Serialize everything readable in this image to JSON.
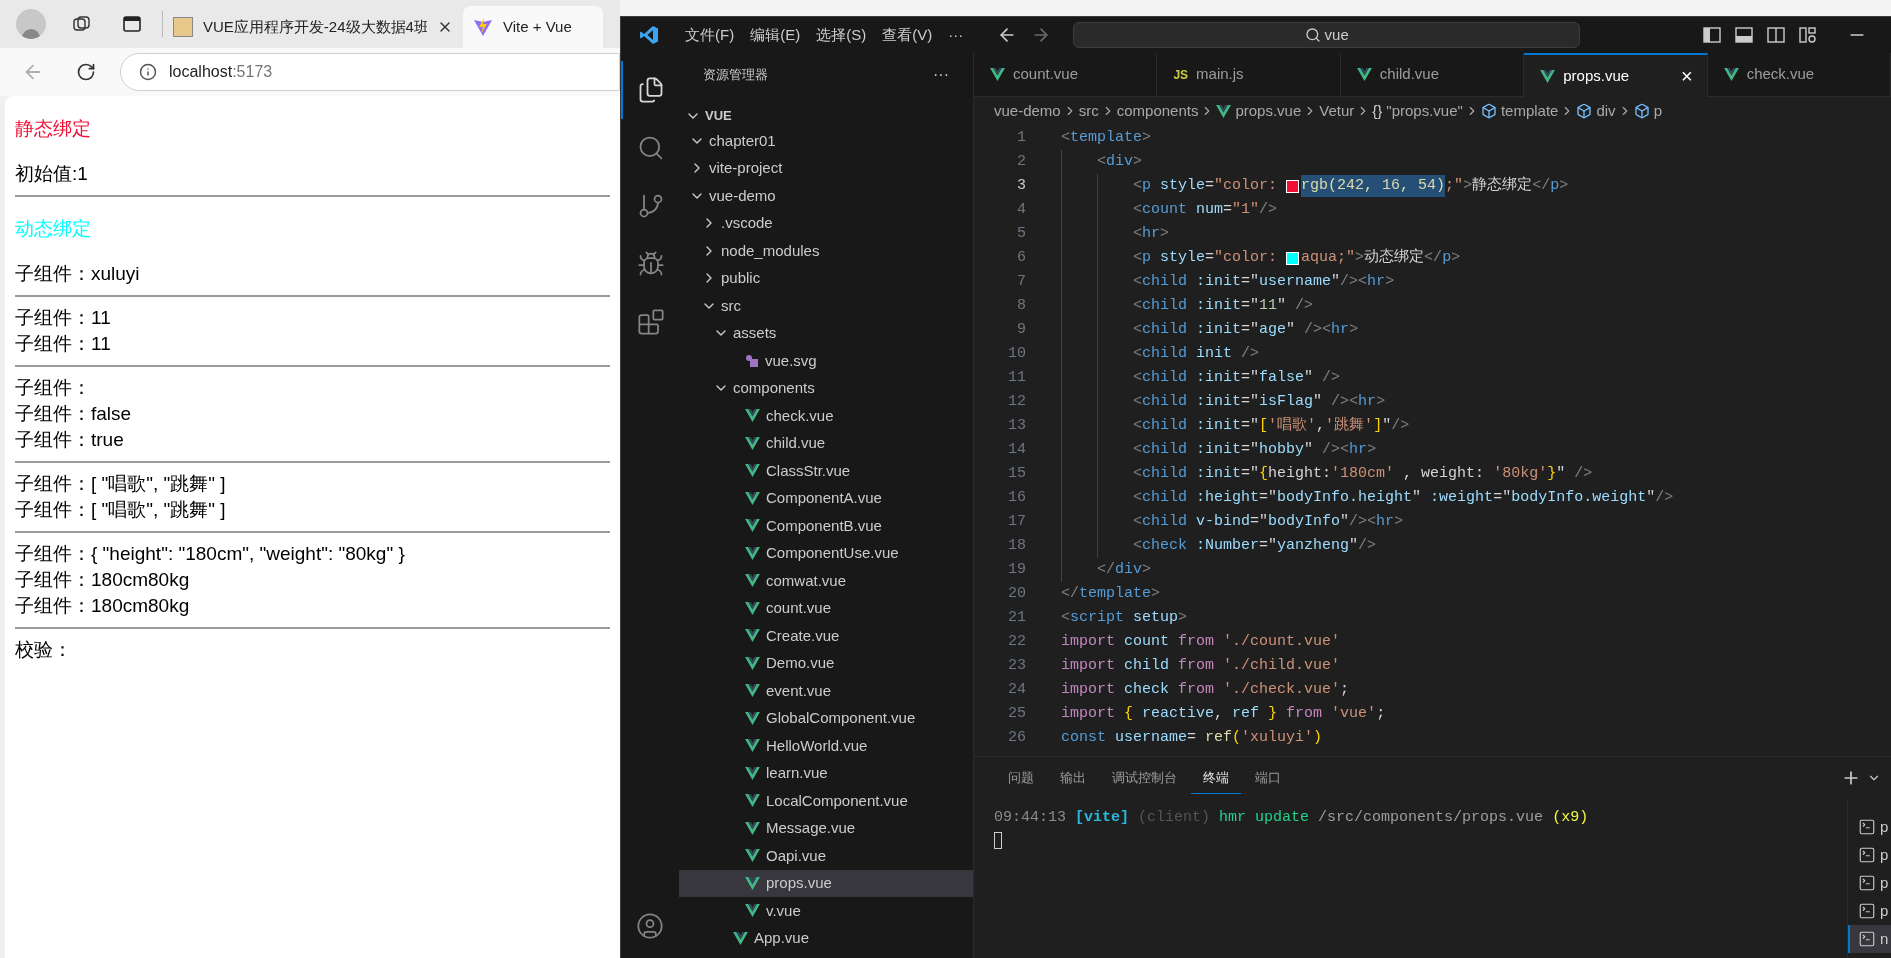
{
  "browser": {
    "tabs": [
      {
        "title": "VUE应用程序开发-24级大数据4班",
        "kind": "page",
        "selected": false,
        "closable": true
      },
      {
        "title": "Vite + Vue",
        "kind": "vite",
        "selected": true,
        "closable": false
      }
    ],
    "address": {
      "host": "localhost",
      "port": ":5173"
    },
    "page": [
      {
        "kind": "p",
        "text": "静态绑定",
        "color": "#f21036"
      },
      {
        "kind": "div",
        "text": "初始值:1",
        "color": "#000000"
      },
      {
        "kind": "hr"
      },
      {
        "kind": "p",
        "text": "动态绑定",
        "color": "#00ffff"
      },
      {
        "kind": "div",
        "text": "子组件：xuluyi",
        "color": "#000000"
      },
      {
        "kind": "hr"
      },
      {
        "kind": "div",
        "text": "子组件：11",
        "color": "#000000"
      },
      {
        "kind": "div",
        "text": "子组件：11",
        "color": "#000000"
      },
      {
        "kind": "hr"
      },
      {
        "kind": "div",
        "text": "子组件：",
        "color": "#000000"
      },
      {
        "kind": "div",
        "text": "子组件：false",
        "color": "#000000"
      },
      {
        "kind": "div",
        "text": "子组件：true",
        "color": "#000000"
      },
      {
        "kind": "hr"
      },
      {
        "kind": "div",
        "text": "子组件：[ \"唱歌\", \"跳舞\" ]",
        "color": "#000000"
      },
      {
        "kind": "div",
        "text": "子组件：[ \"唱歌\", \"跳舞\" ]",
        "color": "#000000"
      },
      {
        "kind": "hr"
      },
      {
        "kind": "div",
        "text": "子组件：{ \"height\": \"180cm\", \"weight\": \"80kg\" }",
        "color": "#000000"
      },
      {
        "kind": "div",
        "text": "子组件：180cm80kg",
        "color": "#000000"
      },
      {
        "kind": "div",
        "text": "子组件：180cm80kg",
        "color": "#000000"
      },
      {
        "kind": "hr"
      },
      {
        "kind": "div",
        "text": "校验：",
        "color": "#000000"
      }
    ]
  },
  "editor_window": {
    "menu": [
      "文件(F)",
      "编辑(E)",
      "选择(S)",
      "查看(V)",
      "···"
    ],
    "search": {
      "value": "vue"
    },
    "activity_bar": [
      {
        "kind": "explorer",
        "selected": true
      },
      {
        "kind": "search",
        "selected": false
      },
      {
        "kind": "source-control",
        "selected": false
      },
      {
        "kind": "run-debug",
        "selected": false
      },
      {
        "kind": "extensions",
        "selected": false
      }
    ],
    "sidebar": {
      "title": "资源管理器",
      "more": "···",
      "section": "VUE",
      "tree": [
        {
          "label": "chapter01",
          "kind": "folder",
          "expanded": true,
          "selected": false
        },
        {
          "label": "vite-project",
          "kind": "folder",
          "expanded": false,
          "selected": false
        },
        {
          "label": "vue-demo",
          "kind": "folder",
          "expanded": true,
          "selected": false,
          "children": [
            {
              "label": ".vscode",
              "kind": "folder",
              "expanded": false,
              "selected": false
            },
            {
              "label": "node_modules",
              "kind": "folder",
              "expanded": false,
              "selected": false
            },
            {
              "label": "public",
              "kind": "folder",
              "expanded": false,
              "selected": false
            },
            {
              "label": "src",
              "kind": "folder",
              "expanded": true,
              "selected": false,
              "children": [
                {
                  "label": "assets",
                  "kind": "folder",
                  "expanded": true,
                  "selected": false,
                  "children": [
                    {
                      "label": "vue.svg",
                      "kind": "svg",
                      "selected": false
                    }
                  ]
                },
                {
                  "label": "components",
                  "kind": "folder",
                  "expanded": true,
                  "selected": false,
                  "children": [
                    {
                      "label": "check.vue",
                      "kind": "vue",
                      "selected": false
                    },
                    {
                      "label": "child.vue",
                      "kind": "vue",
                      "selected": false
                    },
                    {
                      "label": "ClassStr.vue",
                      "kind": "vue",
                      "selected": false
                    },
                    {
                      "label": "ComponentA.vue",
                      "kind": "vue",
                      "selected": false
                    },
                    {
                      "label": "ComponentB.vue",
                      "kind": "vue",
                      "selected": false
                    },
                    {
                      "label": "ComponentUse.vue",
                      "kind": "vue",
                      "selected": false
                    },
                    {
                      "label": "comwat.vue",
                      "kind": "vue",
                      "selected": false
                    },
                    {
                      "label": "count.vue",
                      "kind": "vue",
                      "selected": false
                    },
                    {
                      "label": "Create.vue",
                      "kind": "vue",
                      "selected": false
                    },
                    {
                      "label": "Demo.vue",
                      "kind": "vue",
                      "selected": false
                    },
                    {
                      "label": "event.vue",
                      "kind": "vue",
                      "selected": false
                    },
                    {
                      "label": "GlobalComponent.vue",
                      "kind": "vue",
                      "selected": false
                    },
                    {
                      "label": "HelloWorld.vue",
                      "kind": "vue",
                      "selected": false
                    },
                    {
                      "label": "learn.vue",
                      "kind": "vue",
                      "selected": false
                    },
                    {
                      "label": "LocalComponent.vue",
                      "kind": "vue",
                      "selected": false
                    },
                    {
                      "label": "Message.vue",
                      "kind": "vue",
                      "selected": false
                    },
                    {
                      "label": "Oapi.vue",
                      "kind": "vue",
                      "selected": false
                    },
                    {
                      "label": "props.vue",
                      "kind": "vue",
                      "selected": true
                    },
                    {
                      "label": "v.vue",
                      "kind": "vue",
                      "selected": false
                    }
                  ]
                },
                {
                  "label": "App.vue",
                  "kind": "vue",
                  "selected": false
                }
              ]
            }
          ]
        }
      ]
    },
    "tabs": [
      {
        "label": "count.vue",
        "kind": "vue",
        "selected": false
      },
      {
        "label": "main.js",
        "kind": "js",
        "badge": "JS",
        "selected": false
      },
      {
        "label": "child.vue",
        "kind": "vue",
        "selected": false
      },
      {
        "label": "props.vue",
        "kind": "vue",
        "selected": true,
        "close": "×"
      },
      {
        "label": "check.vue",
        "kind": "vue",
        "selected": false
      }
    ],
    "breadcrumb": [
      {
        "label": "vue-demo",
        "kind": "folder"
      },
      {
        "label": "src",
        "kind": "folder"
      },
      {
        "label": "components",
        "kind": "folder"
      },
      {
        "label": "props.vue",
        "kind": "vue"
      },
      {
        "label": "Vetur",
        "kind": "folder"
      },
      {
        "label": "\"props.vue\"",
        "kind": "object",
        "symbol": "{}"
      },
      {
        "label": "template",
        "kind": "element"
      },
      {
        "label": "div",
        "kind": "element"
      },
      {
        "label": "p",
        "kind": "element"
      }
    ],
    "code": [
      {
        "number": "1",
        "active": false,
        "tokens": [
          {
            "kind": "punct",
            "text": "<"
          },
          {
            "kind": "tag",
            "text": "template"
          },
          {
            "kind": "punct",
            "text": ">"
          }
        ]
      },
      {
        "number": "2",
        "active": false,
        "tokens": [
          {
            "kind": "punct",
            "text": "    <"
          },
          {
            "kind": "tag",
            "text": "div"
          },
          {
            "kind": "punct",
            "text": ">"
          }
        ]
      },
      {
        "number": "3",
        "active": true,
        "tokens": [
          {
            "kind": "punct",
            "text": "        <"
          },
          {
            "kind": "tag",
            "text": "p"
          },
          {
            "kind": "attr",
            "text": " style"
          },
          {
            "kind": "plain",
            "text": "="
          },
          {
            "kind": "string",
            "text": "\"color: "
          },
          {
            "kind": "swatch",
            "color": "#f21036"
          },
          {
            "kind": "selection",
            "text": "rgb(242, 16, 54)"
          },
          {
            "kind": "string",
            "text": ";\""
          },
          {
            "kind": "punct",
            "text": ">"
          },
          {
            "kind": "plain",
            "text": "静态绑定"
          },
          {
            "kind": "punct",
            "text": "</"
          },
          {
            "kind": "tag",
            "text": "p"
          },
          {
            "kind": "punct",
            "text": ">"
          }
        ]
      },
      {
        "number": "4",
        "active": false,
        "tokens": [
          {
            "kind": "punct",
            "text": "        <"
          },
          {
            "kind": "tag",
            "text": "count"
          },
          {
            "kind": "attr",
            "text": " num"
          },
          {
            "kind": "plain",
            "text": "="
          },
          {
            "kind": "string",
            "text": "\"1\""
          },
          {
            "kind": "punct",
            "text": "/>"
          }
        ]
      },
      {
        "number": "5",
        "active": false,
        "tokens": [
          {
            "kind": "punct",
            "text": "        <"
          },
          {
            "kind": "tag",
            "text": "hr"
          },
          {
            "kind": "punct",
            "text": ">"
          }
        ]
      },
      {
        "number": "6",
        "active": false,
        "tokens": [
          {
            "kind": "punct",
            "text": "        <"
          },
          {
            "kind": "tag",
            "text": "p"
          },
          {
            "kind": "attr",
            "text": " style"
          },
          {
            "kind": "plain",
            "text": "="
          },
          {
            "kind": "string",
            "text": "\"color: "
          },
          {
            "kind": "swatch",
            "color": "#00ffff"
          },
          {
            "kind": "string",
            "text": "aqua;\""
          },
          {
            "kind": "punct",
            "text": ">"
          },
          {
            "kind": "plain",
            "text": "动态绑定"
          },
          {
            "kind": "punct",
            "text": "</"
          },
          {
            "kind": "tag",
            "text": "p"
          },
          {
            "kind": "punct",
            "text": ">"
          }
        ]
      },
      {
        "number": "7",
        "active": false,
        "tokens": [
          {
            "kind": "punct",
            "text": "        <"
          },
          {
            "kind": "tag",
            "text": "child"
          },
          {
            "kind": "attr",
            "text": " :init"
          },
          {
            "kind": "plain",
            "text": "=\""
          },
          {
            "kind": "expr",
            "text": "username"
          },
          {
            "kind": "plain",
            "text": "\""
          },
          {
            "kind": "punct",
            "text": "/><"
          },
          {
            "kind": "tag",
            "text": "hr"
          },
          {
            "kind": "punct",
            "text": ">"
          }
        ]
      },
      {
        "number": "8",
        "active": false,
        "tokens": [
          {
            "kind": "punct",
            "text": "        <"
          },
          {
            "kind": "tag",
            "text": "child"
          },
          {
            "kind": "attr",
            "text": " :init"
          },
          {
            "kind": "plain",
            "text": "=\""
          },
          {
            "kind": "number",
            "text": "11"
          },
          {
            "kind": "plain",
            "text": "\" "
          },
          {
            "kind": "punct",
            "text": "/>"
          }
        ]
      },
      {
        "number": "9",
        "active": false,
        "tokens": [
          {
            "kind": "punct",
            "text": "        <"
          },
          {
            "kind": "tag",
            "text": "child"
          },
          {
            "kind": "attr",
            "text": " :init"
          },
          {
            "kind": "plain",
            "text": "=\""
          },
          {
            "kind": "expr",
            "text": "age"
          },
          {
            "kind": "plain",
            "text": "\" "
          },
          {
            "kind": "punct",
            "text": "/><"
          },
          {
            "kind": "tag",
            "text": "hr"
          },
          {
            "kind": "punct",
            "text": ">"
          }
        ]
      },
      {
        "number": "10",
        "active": false,
        "tokens": [
          {
            "kind": "punct",
            "text": "        <"
          },
          {
            "kind": "tag",
            "text": "child"
          },
          {
            "kind": "attr",
            "text": " init "
          },
          {
            "kind": "punct",
            "text": "/>"
          }
        ]
      },
      {
        "number": "11",
        "active": false,
        "tokens": [
          {
            "kind": "punct",
            "text": "        <"
          },
          {
            "kind": "tag",
            "text": "child"
          },
          {
            "kind": "attr",
            "text": " :init"
          },
          {
            "kind": "plain",
            "text": "=\""
          },
          {
            "kind": "expr",
            "text": "false"
          },
          {
            "kind": "plain",
            "text": "\" "
          },
          {
            "kind": "punct",
            "text": "/>"
          }
        ]
      },
      {
        "number": "12",
        "active": false,
        "tokens": [
          {
            "kind": "punct",
            "text": "        <"
          },
          {
            "kind": "tag",
            "text": "child"
          },
          {
            "kind": "attr",
            "text": " :init"
          },
          {
            "kind": "plain",
            "text": "=\""
          },
          {
            "kind": "expr",
            "text": "isFlag"
          },
          {
            "kind": "plain",
            "text": "\" "
          },
          {
            "kind": "punct",
            "text": "/><"
          },
          {
            "kind": "tag",
            "text": "hr"
          },
          {
            "kind": "punct",
            "text": ">"
          }
        ]
      },
      {
        "number": "13",
        "active": false,
        "tokens": [
          {
            "kind": "punct",
            "text": "        <"
          },
          {
            "kind": "tag",
            "text": "child"
          },
          {
            "kind": "attr",
            "text": " :init"
          },
          {
            "kind": "plain",
            "text": "=\""
          },
          {
            "kind": "bracket",
            "text": "["
          },
          {
            "kind": "string",
            "text": "'唱歌'"
          },
          {
            "kind": "plain",
            "text": ","
          },
          {
            "kind": "string",
            "text": "'跳舞'"
          },
          {
            "kind": "bracket",
            "text": "]"
          },
          {
            "kind": "plain",
            "text": "\""
          },
          {
            "kind": "punct",
            "text": "/>"
          }
        ]
      },
      {
        "number": "14",
        "active": false,
        "tokens": [
          {
            "kind": "punct",
            "text": "        <"
          },
          {
            "kind": "tag",
            "text": "child"
          },
          {
            "kind": "attr",
            "text": " :init"
          },
          {
            "kind": "plain",
            "text": "=\""
          },
          {
            "kind": "expr",
            "text": "hobby"
          },
          {
            "kind": "plain",
            "text": "\" "
          },
          {
            "kind": "punct",
            "text": "/><"
          },
          {
            "kind": "tag",
            "text": "hr"
          },
          {
            "kind": "punct",
            "text": ">"
          }
        ]
      },
      {
        "number": "15",
        "active": false,
        "tokens": [
          {
            "kind": "punct",
            "text": "        <"
          },
          {
            "kind": "tag",
            "text": "child"
          },
          {
            "kind": "attr",
            "text": " :init"
          },
          {
            "kind": "plain",
            "text": "=\""
          },
          {
            "kind": "bracket",
            "text": "{"
          },
          {
            "kind": "plain",
            "text": "height:"
          },
          {
            "kind": "string",
            "text": "'180cm'"
          },
          {
            "kind": "plain",
            "text": " , weight: "
          },
          {
            "kind": "string",
            "text": "'80kg'"
          },
          {
            "kind": "bracket",
            "text": "}"
          },
          {
            "kind": "plain",
            "text": "\" "
          },
          {
            "kind": "punct",
            "text": "/>"
          }
        ]
      },
      {
        "number": "16",
        "active": false,
        "tokens": [
          {
            "kind": "punct",
            "text": "        <"
          },
          {
            "kind": "tag",
            "text": "child"
          },
          {
            "kind": "attr",
            "text": " :height"
          },
          {
            "kind": "plain",
            "text": "=\""
          },
          {
            "kind": "expr",
            "text": "bodyInfo.height"
          },
          {
            "kind": "plain",
            "text": "\""
          },
          {
            "kind": "attr",
            "text": " :weight"
          },
          {
            "kind": "plain",
            "text": "=\""
          },
          {
            "kind": "expr",
            "text": "bodyInfo.weight"
          },
          {
            "kind": "plain",
            "text": "\""
          },
          {
            "kind": "punct",
            "text": "/>"
          }
        ]
      },
      {
        "number": "17",
        "active": false,
        "tokens": [
          {
            "kind": "punct",
            "text": "        <"
          },
          {
            "kind": "tag",
            "text": "child"
          },
          {
            "kind": "attr",
            "text": " v-bind"
          },
          {
            "kind": "plain",
            "text": "=\""
          },
          {
            "kind": "expr",
            "text": "bodyInfo"
          },
          {
            "kind": "plain",
            "text": "\""
          },
          {
            "kind": "punct",
            "text": "/><"
          },
          {
            "kind": "tag",
            "text": "hr"
          },
          {
            "kind": "punct",
            "text": ">"
          }
        ]
      },
      {
        "number": "18",
        "active": false,
        "tokens": [
          {
            "kind": "punct",
            "text": "        <"
          },
          {
            "kind": "tag",
            "text": "check"
          },
          {
            "kind": "attr",
            "text": " :Number"
          },
          {
            "kind": "plain",
            "text": "=\""
          },
          {
            "kind": "expr",
            "text": "yanzheng"
          },
          {
            "kind": "plain",
            "text": "\""
          },
          {
            "kind": "punct",
            "text": "/>"
          }
        ]
      },
      {
        "number": "19",
        "active": false,
        "tokens": [
          {
            "kind": "punct",
            "text": "    </"
          },
          {
            "kind": "tag",
            "text": "div"
          },
          {
            "kind": "punct",
            "text": ">"
          }
        ]
      },
      {
        "number": "20",
        "active": false,
        "tokens": [
          {
            "kind": "punct",
            "text": "</"
          },
          {
            "kind": "tag",
            "text": "template"
          },
          {
            "kind": "punct",
            "text": ">"
          }
        ]
      },
      {
        "number": "21",
        "active": false,
        "tokens": [
          {
            "kind": "punct",
            "text": "<"
          },
          {
            "kind": "tag",
            "text": "script"
          },
          {
            "kind": "attr",
            "text": " setup"
          },
          {
            "kind": "punct",
            "text": ">"
          }
        ]
      },
      {
        "number": "22",
        "active": false,
        "tokens": [
          {
            "kind": "keyword",
            "text": "import"
          },
          {
            "kind": "expr",
            "text": " count "
          },
          {
            "kind": "keyword",
            "text": "from"
          },
          {
            "kind": "string",
            "text": " './count.vue'"
          }
        ]
      },
      {
        "number": "23",
        "active": false,
        "tokens": [
          {
            "kind": "keyword",
            "text": "import"
          },
          {
            "kind": "expr",
            "text": " child "
          },
          {
            "kind": "keyword",
            "text": "from"
          },
          {
            "kind": "string",
            "text": " './child.vue'"
          }
        ]
      },
      {
        "number": "24",
        "active": false,
        "tokens": [
          {
            "kind": "keyword",
            "text": "import"
          },
          {
            "kind": "expr",
            "text": " check "
          },
          {
            "kind": "keyword",
            "text": "from"
          },
          {
            "kind": "string",
            "text": " './check.vue'"
          },
          {
            "kind": "plain",
            "text": ";"
          }
        ]
      },
      {
        "number": "25",
        "active": false,
        "tokens": [
          {
            "kind": "keyword",
            "text": "import"
          },
          {
            "kind": "bracket",
            "text": " { "
          },
          {
            "kind": "expr",
            "text": "reactive"
          },
          {
            "kind": "plain",
            "text": ", "
          },
          {
            "kind": "expr",
            "text": "ref"
          },
          {
            "kind": "bracket",
            "text": " } "
          },
          {
            "kind": "keyword",
            "text": "from"
          },
          {
            "kind": "string",
            "text": " 'vue'"
          },
          {
            "kind": "plain",
            "text": ";"
          }
        ]
      },
      {
        "number": "26",
        "active": false,
        "tokens": [
          {
            "kind": "storage",
            "text": "const"
          },
          {
            "kind": "expr",
            "text": " username"
          },
          {
            "kind": "plain",
            "text": "= "
          },
          {
            "kind": "func",
            "text": "ref"
          },
          {
            "kind": "bracket",
            "text": "("
          },
          {
            "kind": "string",
            "text": "'xuluyi'"
          },
          {
            "kind": "bracket",
            "text": ")"
          }
        ]
      }
    ],
    "panel": {
      "tabs": [
        {
          "label": "问题",
          "selected": false
        },
        {
          "label": "输出",
          "selected": false
        },
        {
          "label": "调试控制台",
          "selected": false
        },
        {
          "label": "终端",
          "selected": true
        },
        {
          "label": "端口",
          "selected": false
        }
      ],
      "terminal": [
        {
          "kind": "time",
          "text": "09:44:13 "
        },
        {
          "kind": "source",
          "text": "[vite]"
        },
        {
          "kind": "dim",
          "text": " (client)"
        },
        {
          "kind": "action",
          "text": " hmr update"
        },
        {
          "kind": "path",
          "text": " /src/components/props.vue"
        },
        {
          "kind": "count",
          "text": " (x9)"
        }
      ],
      "terminals": [
        {
          "label": "p",
          "selected": false
        },
        {
          "label": "p",
          "selected": false
        },
        {
          "label": "p",
          "selected": false
        },
        {
          "label": "p",
          "selected": false
        },
        {
          "label": "n",
          "selected": true
        }
      ]
    }
  }
}
